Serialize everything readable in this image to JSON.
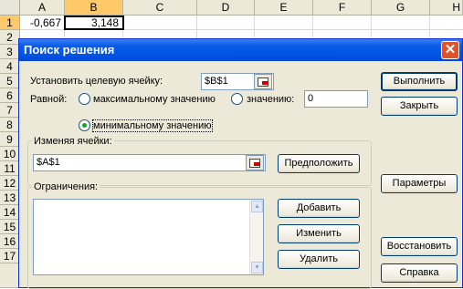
{
  "sheet": {
    "columns": [
      "A",
      "B",
      "C",
      "D",
      "E",
      "F",
      "G",
      "H"
    ],
    "rows": [
      "1",
      "2",
      "3",
      "4",
      "5",
      "6",
      "7",
      "8",
      "9",
      "10",
      "11",
      "12",
      "13",
      "14",
      "15",
      "16",
      "17"
    ],
    "cell_a1": "-0,667",
    "cell_b1": "3,148"
  },
  "dialog": {
    "title": "Поиск решения",
    "target_label": "Установить целевую ячейку:",
    "target_value": "$B$1",
    "equal_label": "Равной:",
    "opt_max": "максимальному значению",
    "opt_value": "значению:",
    "value_input": "0",
    "opt_min": "минимальному значению",
    "changing_label": "Изменяя ячейки:",
    "changing_value": "$A$1",
    "guess_button": "Предположить",
    "constraints_label": "Ограничения:",
    "add_button": "Добавить",
    "change_button": "Изменить",
    "delete_button": "Удалить",
    "solve_button": "Выполнить",
    "close_button": "Закрыть",
    "options_button": "Параметры",
    "reset_button": "Восстановить",
    "help_button": "Справка",
    "selected_option": "min"
  },
  "icons": {
    "close": "close-icon",
    "ref": "cell-reference-icon"
  }
}
